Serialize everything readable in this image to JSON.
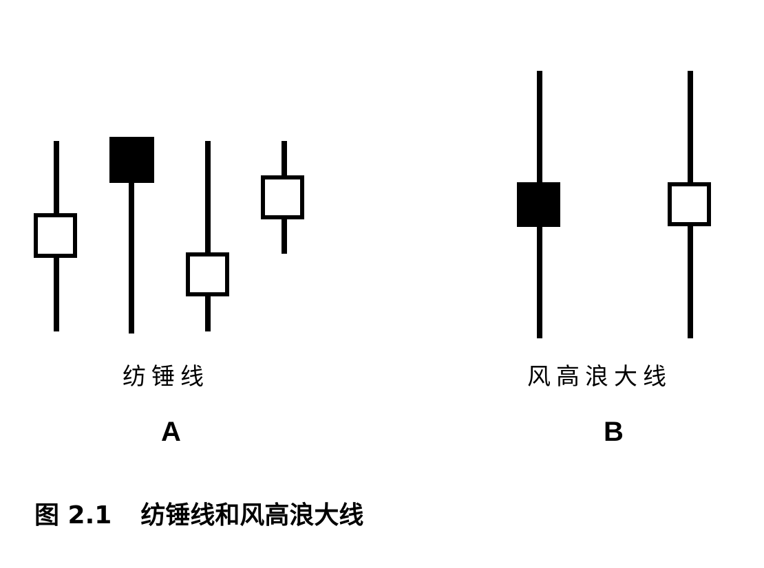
{
  "panel_a": {
    "label": "纺锤线",
    "letter": "A"
  },
  "panel_b": {
    "label": "风高浪大线",
    "letter": "B"
  },
  "caption": {
    "number": "图 2.1",
    "text": "纺锤线和风高浪大线"
  },
  "colors": {
    "ink": "#000000",
    "hollow_body": "#ffffff"
  }
}
